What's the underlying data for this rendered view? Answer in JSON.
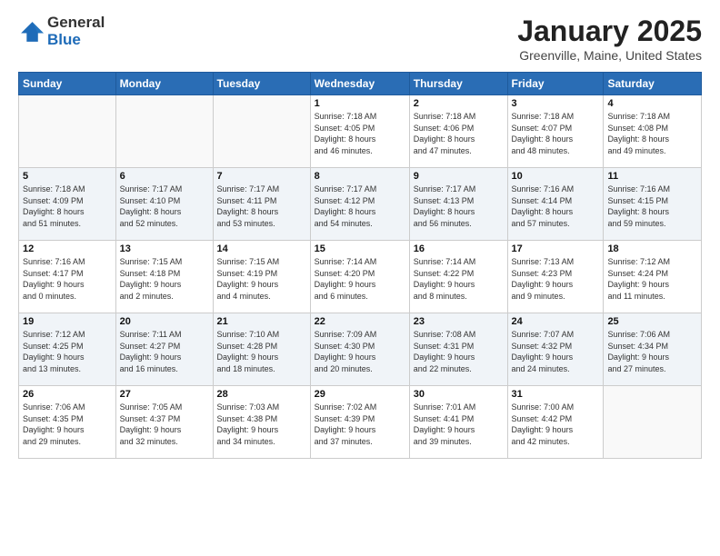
{
  "header": {
    "logo_general": "General",
    "logo_blue": "Blue",
    "title": "January 2025",
    "location": "Greenville, Maine, United States"
  },
  "days_of_week": [
    "Sunday",
    "Monday",
    "Tuesday",
    "Wednesday",
    "Thursday",
    "Friday",
    "Saturday"
  ],
  "weeks": [
    [
      {
        "day": "",
        "info": ""
      },
      {
        "day": "",
        "info": ""
      },
      {
        "day": "",
        "info": ""
      },
      {
        "day": "1",
        "info": "Sunrise: 7:18 AM\nSunset: 4:05 PM\nDaylight: 8 hours\nand 46 minutes."
      },
      {
        "day": "2",
        "info": "Sunrise: 7:18 AM\nSunset: 4:06 PM\nDaylight: 8 hours\nand 47 minutes."
      },
      {
        "day": "3",
        "info": "Sunrise: 7:18 AM\nSunset: 4:07 PM\nDaylight: 8 hours\nand 48 minutes."
      },
      {
        "day": "4",
        "info": "Sunrise: 7:18 AM\nSunset: 4:08 PM\nDaylight: 8 hours\nand 49 minutes."
      }
    ],
    [
      {
        "day": "5",
        "info": "Sunrise: 7:18 AM\nSunset: 4:09 PM\nDaylight: 8 hours\nand 51 minutes."
      },
      {
        "day": "6",
        "info": "Sunrise: 7:17 AM\nSunset: 4:10 PM\nDaylight: 8 hours\nand 52 minutes."
      },
      {
        "day": "7",
        "info": "Sunrise: 7:17 AM\nSunset: 4:11 PM\nDaylight: 8 hours\nand 53 minutes."
      },
      {
        "day": "8",
        "info": "Sunrise: 7:17 AM\nSunset: 4:12 PM\nDaylight: 8 hours\nand 54 minutes."
      },
      {
        "day": "9",
        "info": "Sunrise: 7:17 AM\nSunset: 4:13 PM\nDaylight: 8 hours\nand 56 minutes."
      },
      {
        "day": "10",
        "info": "Sunrise: 7:16 AM\nSunset: 4:14 PM\nDaylight: 8 hours\nand 57 minutes."
      },
      {
        "day": "11",
        "info": "Sunrise: 7:16 AM\nSunset: 4:15 PM\nDaylight: 8 hours\nand 59 minutes."
      }
    ],
    [
      {
        "day": "12",
        "info": "Sunrise: 7:16 AM\nSunset: 4:17 PM\nDaylight: 9 hours\nand 0 minutes."
      },
      {
        "day": "13",
        "info": "Sunrise: 7:15 AM\nSunset: 4:18 PM\nDaylight: 9 hours\nand 2 minutes."
      },
      {
        "day": "14",
        "info": "Sunrise: 7:15 AM\nSunset: 4:19 PM\nDaylight: 9 hours\nand 4 minutes."
      },
      {
        "day": "15",
        "info": "Sunrise: 7:14 AM\nSunset: 4:20 PM\nDaylight: 9 hours\nand 6 minutes."
      },
      {
        "day": "16",
        "info": "Sunrise: 7:14 AM\nSunset: 4:22 PM\nDaylight: 9 hours\nand 8 minutes."
      },
      {
        "day": "17",
        "info": "Sunrise: 7:13 AM\nSunset: 4:23 PM\nDaylight: 9 hours\nand 9 minutes."
      },
      {
        "day": "18",
        "info": "Sunrise: 7:12 AM\nSunset: 4:24 PM\nDaylight: 9 hours\nand 11 minutes."
      }
    ],
    [
      {
        "day": "19",
        "info": "Sunrise: 7:12 AM\nSunset: 4:25 PM\nDaylight: 9 hours\nand 13 minutes."
      },
      {
        "day": "20",
        "info": "Sunrise: 7:11 AM\nSunset: 4:27 PM\nDaylight: 9 hours\nand 16 minutes."
      },
      {
        "day": "21",
        "info": "Sunrise: 7:10 AM\nSunset: 4:28 PM\nDaylight: 9 hours\nand 18 minutes."
      },
      {
        "day": "22",
        "info": "Sunrise: 7:09 AM\nSunset: 4:30 PM\nDaylight: 9 hours\nand 20 minutes."
      },
      {
        "day": "23",
        "info": "Sunrise: 7:08 AM\nSunset: 4:31 PM\nDaylight: 9 hours\nand 22 minutes."
      },
      {
        "day": "24",
        "info": "Sunrise: 7:07 AM\nSunset: 4:32 PM\nDaylight: 9 hours\nand 24 minutes."
      },
      {
        "day": "25",
        "info": "Sunrise: 7:06 AM\nSunset: 4:34 PM\nDaylight: 9 hours\nand 27 minutes."
      }
    ],
    [
      {
        "day": "26",
        "info": "Sunrise: 7:06 AM\nSunset: 4:35 PM\nDaylight: 9 hours\nand 29 minutes."
      },
      {
        "day": "27",
        "info": "Sunrise: 7:05 AM\nSunset: 4:37 PM\nDaylight: 9 hours\nand 32 minutes."
      },
      {
        "day": "28",
        "info": "Sunrise: 7:03 AM\nSunset: 4:38 PM\nDaylight: 9 hours\nand 34 minutes."
      },
      {
        "day": "29",
        "info": "Sunrise: 7:02 AM\nSunset: 4:39 PM\nDaylight: 9 hours\nand 37 minutes."
      },
      {
        "day": "30",
        "info": "Sunrise: 7:01 AM\nSunset: 4:41 PM\nDaylight: 9 hours\nand 39 minutes."
      },
      {
        "day": "31",
        "info": "Sunrise: 7:00 AM\nSunset: 4:42 PM\nDaylight: 9 hours\nand 42 minutes."
      },
      {
        "day": "",
        "info": ""
      }
    ]
  ]
}
